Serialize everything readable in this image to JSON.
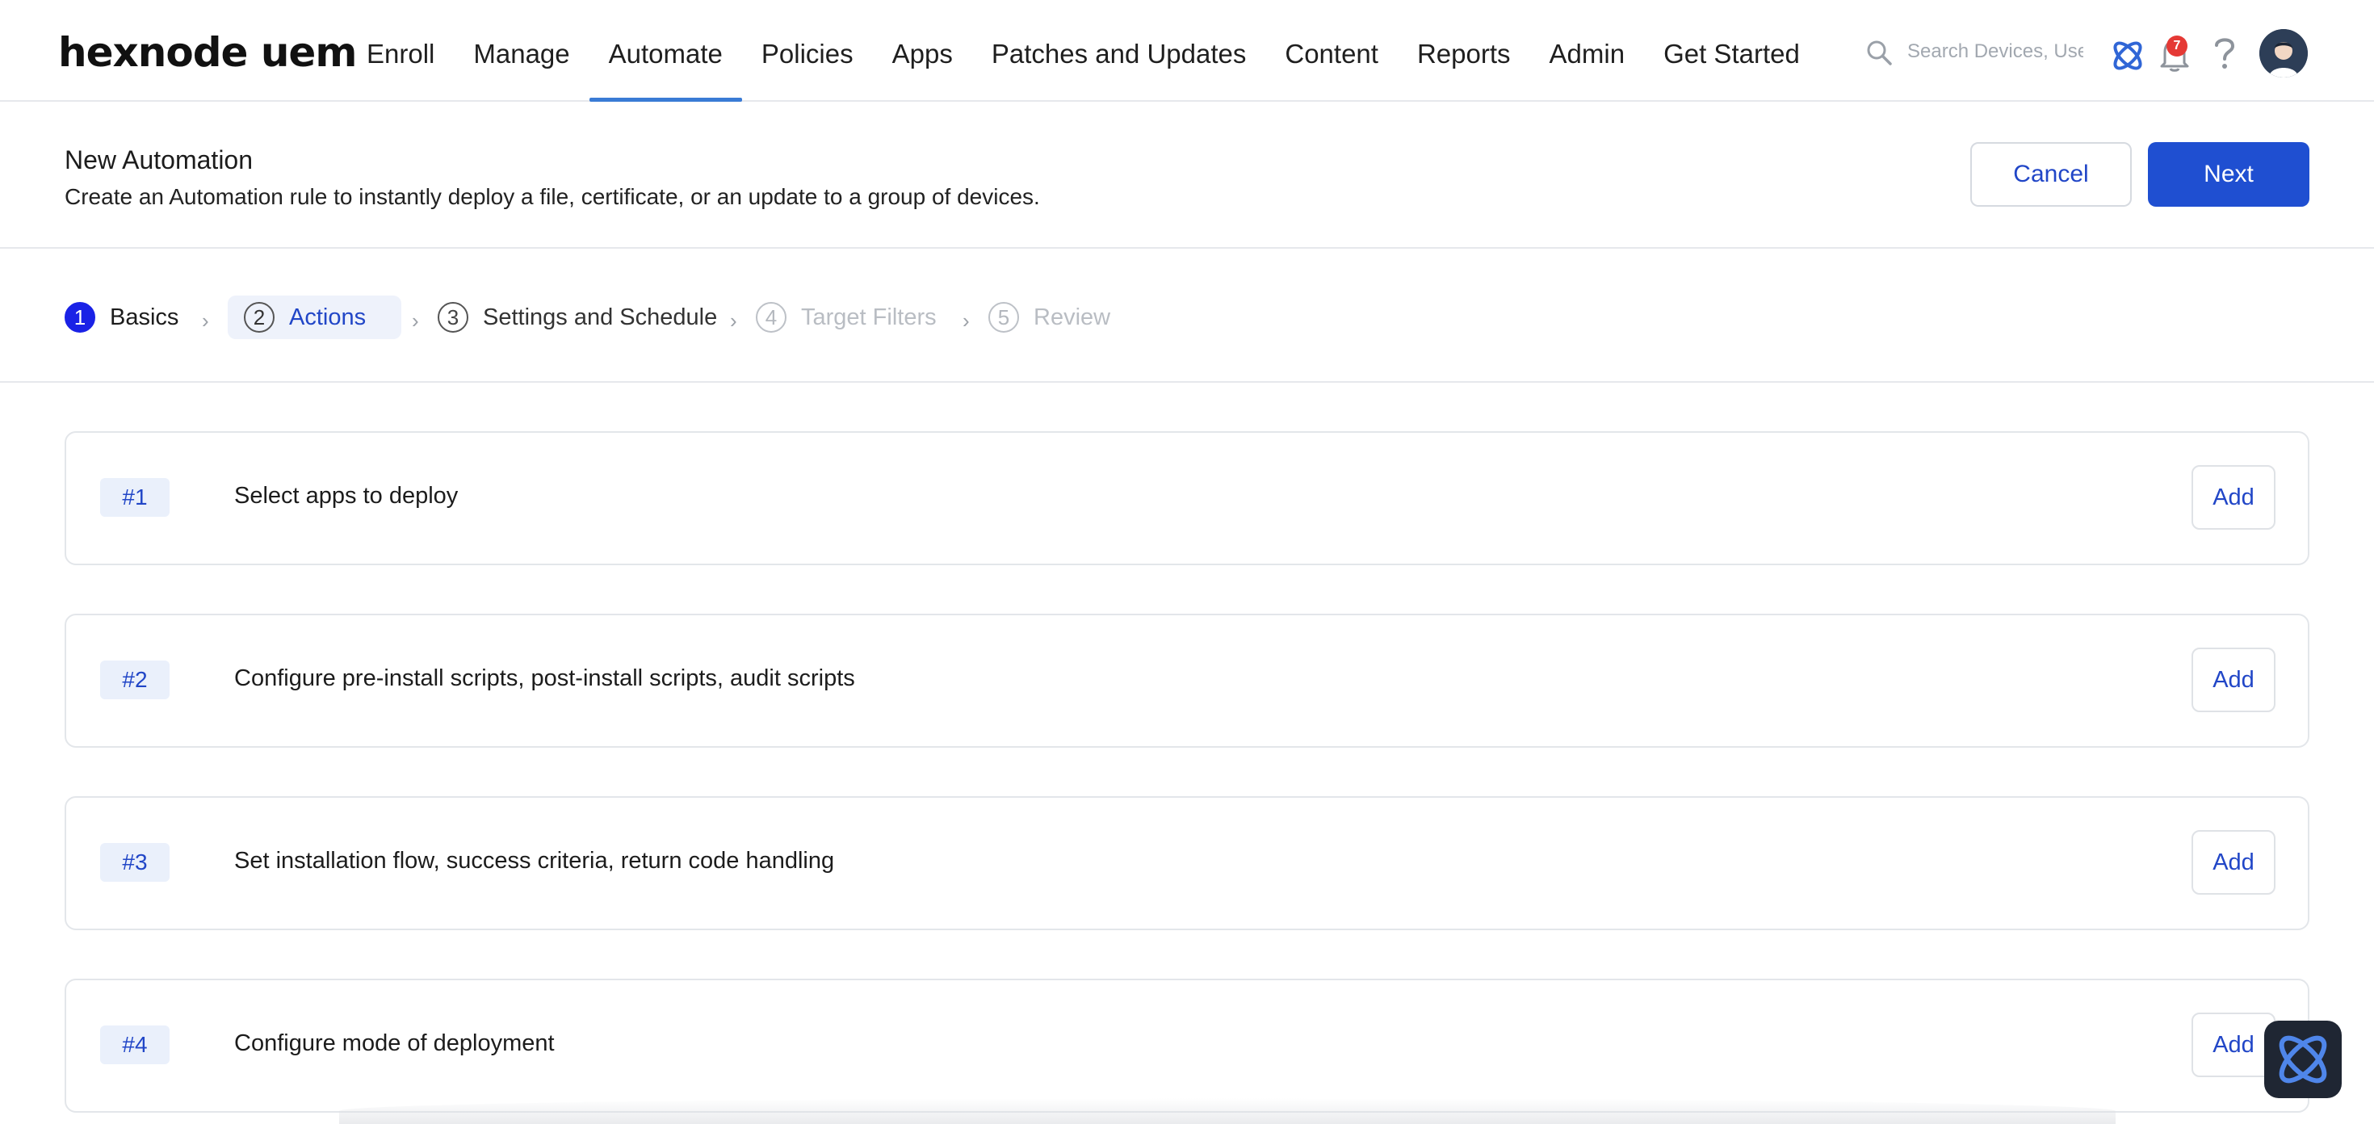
{
  "brand": {
    "logo_text": "hexnode uem"
  },
  "nav": {
    "items": [
      {
        "label": "Enroll"
      },
      {
        "label": "Manage"
      },
      {
        "label": "Automate",
        "active": true
      },
      {
        "label": "Policies"
      },
      {
        "label": "Apps"
      },
      {
        "label": "Patches and Updates"
      },
      {
        "label": "Content"
      },
      {
        "label": "Reports"
      },
      {
        "label": "Admin"
      },
      {
        "label": "Get Started"
      }
    ],
    "search_placeholder": "Search Devices, Use",
    "notification_count": "7",
    "icons": [
      "search-icon",
      "hexnode-logo-icon",
      "bell-icon",
      "help-icon",
      "avatar"
    ]
  },
  "header": {
    "title": "New Automation",
    "subtitle": "Create an Automation rule to instantly deploy a file, certificate, or an update to a group of devices.",
    "cancel_label": "Cancel",
    "next_label": "Next"
  },
  "stepper": {
    "steps": [
      {
        "num": "1",
        "label": "Basics",
        "state": "done"
      },
      {
        "num": "2",
        "label": "Actions",
        "state": "current"
      },
      {
        "num": "3",
        "label": "Settings and Schedule",
        "state": "pending"
      },
      {
        "num": "4",
        "label": "Target Filters",
        "state": "disabled"
      },
      {
        "num": "5",
        "label": "Review",
        "state": "disabled"
      }
    ]
  },
  "actions": [
    {
      "num": "#1",
      "text": "Select apps to deploy",
      "button": "Add"
    },
    {
      "num": "#2",
      "text": "Configure pre-install scripts, post-install scripts, audit scripts",
      "button": "Add"
    },
    {
      "num": "#3",
      "text": "Set installation flow, success criteria, return code handling",
      "button": "Add"
    },
    {
      "num": "#4",
      "text": "Configure mode of deployment",
      "button": "Add"
    }
  ],
  "colors": {
    "primary": "#1f4fd1",
    "accent_link": "#2146c7",
    "nav_underline": "#3a7bd5",
    "badge": "#e53935"
  }
}
